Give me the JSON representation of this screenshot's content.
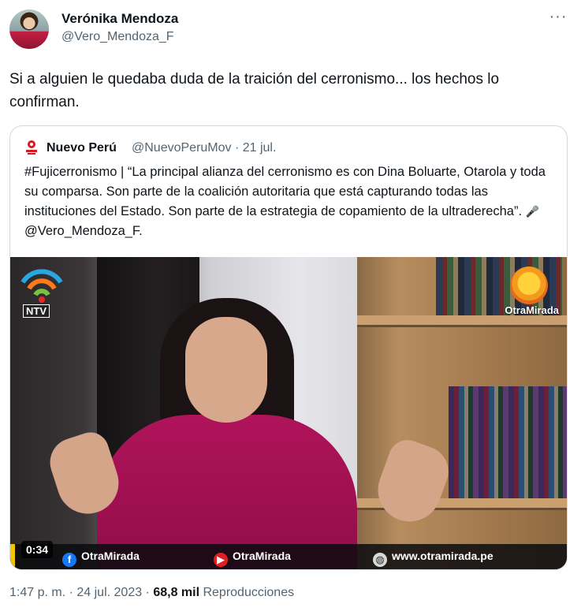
{
  "author": {
    "name": "Verónika Mendoza",
    "handle": "@Vero_Mendoza_F",
    "avatar_icon": "profile-photo",
    "more_icon": "more-horizontal-icon"
  },
  "tweet": {
    "text": "Si a alguien le quedaba duda de la traición del cerronismo... los hechos lo confirman."
  },
  "quoted": {
    "name": "Nuevo Perú",
    "handle_date": "@NuevoPeruMov · 21 jul.",
    "text_before": "#Fujicerronismo | “La principal alianza del cerronismo es con Dina Boluarte, Otarola y toda su comparsa. Son parte de la coalición autoritaria que está capturando todas las instituciones del Estado. Son parte de la estrategia de copamiento de la ultraderecha”. ",
    "mic_emoji": "🎤",
    "text_after": "@Vero_Mendoza_F."
  },
  "video": {
    "ntv_label": "NTV",
    "om_label": "OtraMirada",
    "duration": "0:34",
    "footer": {
      "facebook": "OtraMirada",
      "youtube": "OtraMirada",
      "website": "www.otramirada.pe"
    },
    "colors": {
      "accent_yellow": "#f2c500",
      "facebook": "#1877f2",
      "youtube": "#e02020"
    }
  },
  "meta": {
    "time": "1:47 p. m.",
    "sep": " · ",
    "date": "24 jul. 2023",
    "sep2": " · ",
    "views": "68,8 mil",
    "views_label": " Reproducciones"
  }
}
